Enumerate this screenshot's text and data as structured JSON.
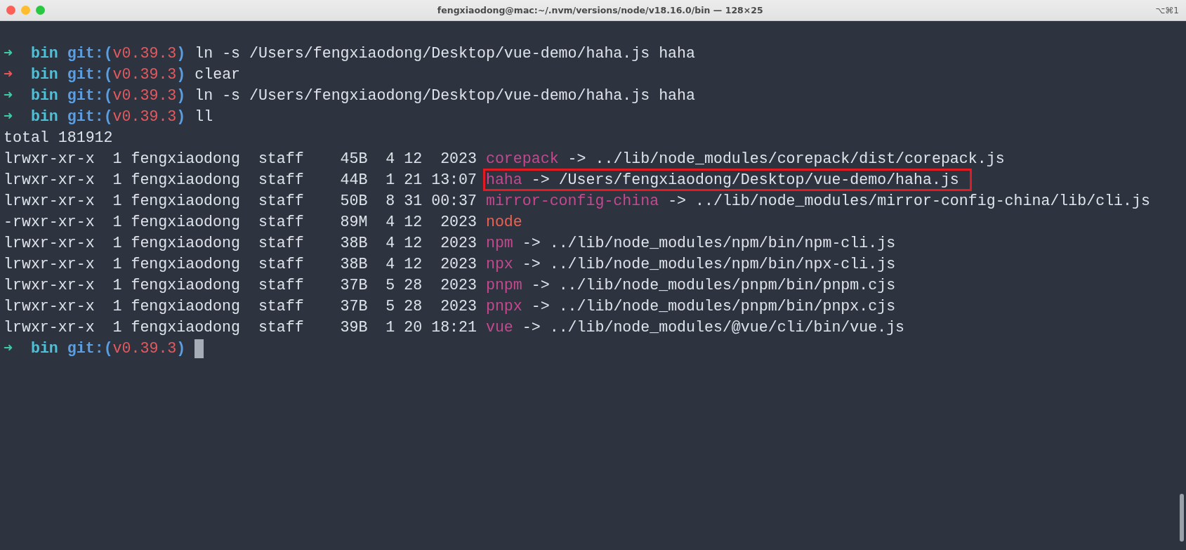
{
  "window": {
    "title": "fengxiaodong@mac:~/.nvm/versions/node/v18.16.0/bin — 128×25",
    "shortcut": "⌥⌘1"
  },
  "lines": [
    {
      "kind": "prompt",
      "failed": false,
      "arrow": "➜",
      "dir": "bin",
      "git_prefix": "git:(",
      "branch": "v0.39.3",
      "git_suffix": ")",
      "command": "ln -s /Users/fengxiaodong/Desktop/vue-demo/haha.js haha",
      "cursor": false
    },
    {
      "kind": "prompt",
      "failed": true,
      "arrow": "➜",
      "dir": "bin",
      "git_prefix": "git:(",
      "branch": "v0.39.3",
      "git_suffix": ")",
      "command": "clear",
      "cursor": false
    },
    {
      "kind": "prompt",
      "failed": false,
      "arrow": "➜",
      "dir": "bin",
      "git_prefix": "git:(",
      "branch": "v0.39.3",
      "git_suffix": ")",
      "command": "ln -s /Users/fengxiaodong/Desktop/vue-demo/haha.js haha",
      "cursor": false
    },
    {
      "kind": "prompt",
      "failed": false,
      "arrow": "➜",
      "dir": "bin",
      "git_prefix": "git:(",
      "branch": "v0.39.3",
      "git_suffix": ")",
      "command": "ll",
      "cursor": false
    },
    {
      "kind": "text",
      "text": "total 181912"
    },
    {
      "kind": "entry",
      "mode": "lrwxr-xr-x",
      "links": "1",
      "owner": "fengxiaodong",
      "group": "staff",
      "size": "45B",
      "month": "4",
      "day": "12",
      "time": "2023",
      "name": "corepack",
      "symlink": true,
      "arrow": "->",
      "target": "../lib/node_modules/corepack/dist/corepack.js",
      "highlighted": false
    },
    {
      "kind": "entry",
      "mode": "lrwxr-xr-x",
      "links": "1",
      "owner": "fengxiaodong",
      "group": "staff",
      "size": "44B",
      "month": "1",
      "day": "21",
      "time": "13:07",
      "name": "haha",
      "symlink": true,
      "arrow": "->",
      "target": "/Users/fengxiaodong/Desktop/vue-demo/haha.js",
      "highlighted": true
    },
    {
      "kind": "entry",
      "mode": "lrwxr-xr-x",
      "links": "1",
      "owner": "fengxiaodong",
      "group": "staff",
      "size": "50B",
      "month": "8",
      "day": "31",
      "time": "00:37",
      "name": "mirror-config-china",
      "symlink": true,
      "arrow": "->",
      "target": "../lib/node_modules/mirror-config-china/lib/cli.js",
      "highlighted": false
    },
    {
      "kind": "entry",
      "mode": "-rwxr-xr-x",
      "links": "1",
      "owner": "fengxiaodong",
      "group": "staff",
      "size": "89M",
      "month": "4",
      "day": "12",
      "time": "2023",
      "name": "node",
      "symlink": false,
      "highlighted": false
    },
    {
      "kind": "entry",
      "mode": "lrwxr-xr-x",
      "links": "1",
      "owner": "fengxiaodong",
      "group": "staff",
      "size": "38B",
      "month": "4",
      "day": "12",
      "time": "2023",
      "name": "npm",
      "symlink": true,
      "arrow": "->",
      "target": "../lib/node_modules/npm/bin/npm-cli.js",
      "highlighted": false
    },
    {
      "kind": "entry",
      "mode": "lrwxr-xr-x",
      "links": "1",
      "owner": "fengxiaodong",
      "group": "staff",
      "size": "38B",
      "month": "4",
      "day": "12",
      "time": "2023",
      "name": "npx",
      "symlink": true,
      "arrow": "->",
      "target": "../lib/node_modules/npm/bin/npx-cli.js",
      "highlighted": false
    },
    {
      "kind": "entry",
      "mode": "lrwxr-xr-x",
      "links": "1",
      "owner": "fengxiaodong",
      "group": "staff",
      "size": "37B",
      "month": "5",
      "day": "28",
      "time": "2023",
      "name": "pnpm",
      "symlink": true,
      "arrow": "->",
      "target": "../lib/node_modules/pnpm/bin/pnpm.cjs",
      "highlighted": false
    },
    {
      "kind": "entry",
      "mode": "lrwxr-xr-x",
      "links": "1",
      "owner": "fengxiaodong",
      "group": "staff",
      "size": "37B",
      "month": "5",
      "day": "28",
      "time": "2023",
      "name": "pnpx",
      "symlink": true,
      "arrow": "->",
      "target": "../lib/node_modules/pnpm/bin/pnpx.cjs",
      "highlighted": false
    },
    {
      "kind": "entry",
      "mode": "lrwxr-xr-x",
      "links": "1",
      "owner": "fengxiaodong",
      "group": "staff",
      "size": "39B",
      "month": "1",
      "day": "20",
      "time": "18:21",
      "name": "vue",
      "symlink": true,
      "arrow": "->",
      "target": "../lib/node_modules/@vue/cli/bin/vue.js",
      "highlighted": false
    },
    {
      "kind": "prompt",
      "failed": false,
      "arrow": "➜",
      "dir": "bin",
      "git_prefix": "git:(",
      "branch": "v0.39.3",
      "git_suffix": ")",
      "cursor": true
    }
  ]
}
